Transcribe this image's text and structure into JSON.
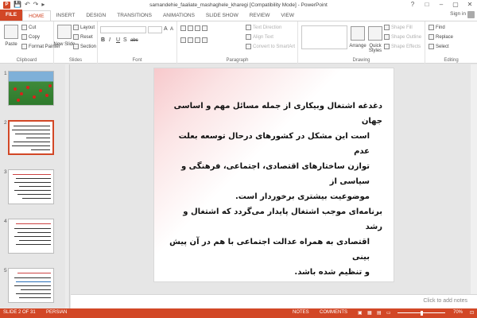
{
  "window": {
    "title": "samandehie_faaliate_mashaghele_kharegi [Compatibility Mode] - PowerPoint",
    "controls": [
      "?",
      "□",
      "–",
      "▢",
      "✕"
    ],
    "app_icon_letter": "P"
  },
  "quick_access": [
    "💾",
    "↶",
    "↷",
    "▸"
  ],
  "tabs": [
    "FILE",
    "HOME",
    "INSERT",
    "DESIGN",
    "TRANSITIONS",
    "ANIMATIONS",
    "SLIDE SHOW",
    "REVIEW",
    "VIEW"
  ],
  "active_tab": "HOME",
  "signin": "Sign in",
  "ribbon": {
    "clipboard": {
      "label": "Clipboard",
      "paste": "Paste",
      "cut": "Cut",
      "copy": "Copy",
      "format_painter": "Format Painter"
    },
    "slides": {
      "label": "Slides",
      "new_slide": "New Slide",
      "layout": "Layout",
      "reset": "Reset",
      "section": "Section"
    },
    "font": {
      "label": "Font",
      "bold": "B",
      "italic": "I",
      "underline": "U",
      "shadow": "S",
      "strike": "abc",
      "grow": "A",
      "shrink": "A"
    },
    "paragraph": {
      "label": "Paragraph",
      "text_direction": "Text Direction",
      "align_text": "Align Text",
      "convert_smartart": "Convert to SmartArt"
    },
    "drawing": {
      "label": "Drawing",
      "arrange": "Arrange",
      "quick_styles": "Quick Styles",
      "shape_fill": "Shape Fill",
      "shape_outline": "Shape Outline",
      "shape_effects": "Shape Effects"
    },
    "editing": {
      "label": "Editing",
      "find": "Find",
      "replace": "Replace",
      "select": "Select"
    }
  },
  "thumbnails": [
    {
      "number": "1"
    },
    {
      "number": "2"
    },
    {
      "number": "3"
    },
    {
      "number": "4"
    },
    {
      "number": "5"
    }
  ],
  "slide": {
    "lines": [
      "دغدغه اشتغال وبیکاری از جمله مسائل مهم و اساسی جهان",
      "است این مشکل در کشورهای درحال توسعه بعلت عدم",
      "توازن ساختارهای اقتصادی، اجتماعی، فرهنگی و سیاسی از",
      "موضوعیت بیشتری برخوردار است.",
      "برنامه‌ای موجب اشتغال پایدار می‌گردد که اشتغال و رشد",
      "اقتصادی به همراه عدالت اجتماعی با هم در آن پیش بینی",
      "و تنظیم شده باشد."
    ]
  },
  "notes_placeholder": "Click to add notes",
  "status": {
    "slide_info": "SLIDE 2 OF 31",
    "language": "PERSIAN",
    "notes": "NOTES",
    "comments": "COMMENTS",
    "zoom": "70%"
  },
  "colors": {
    "accent": "#d24726",
    "status_bar": "#d24726"
  }
}
